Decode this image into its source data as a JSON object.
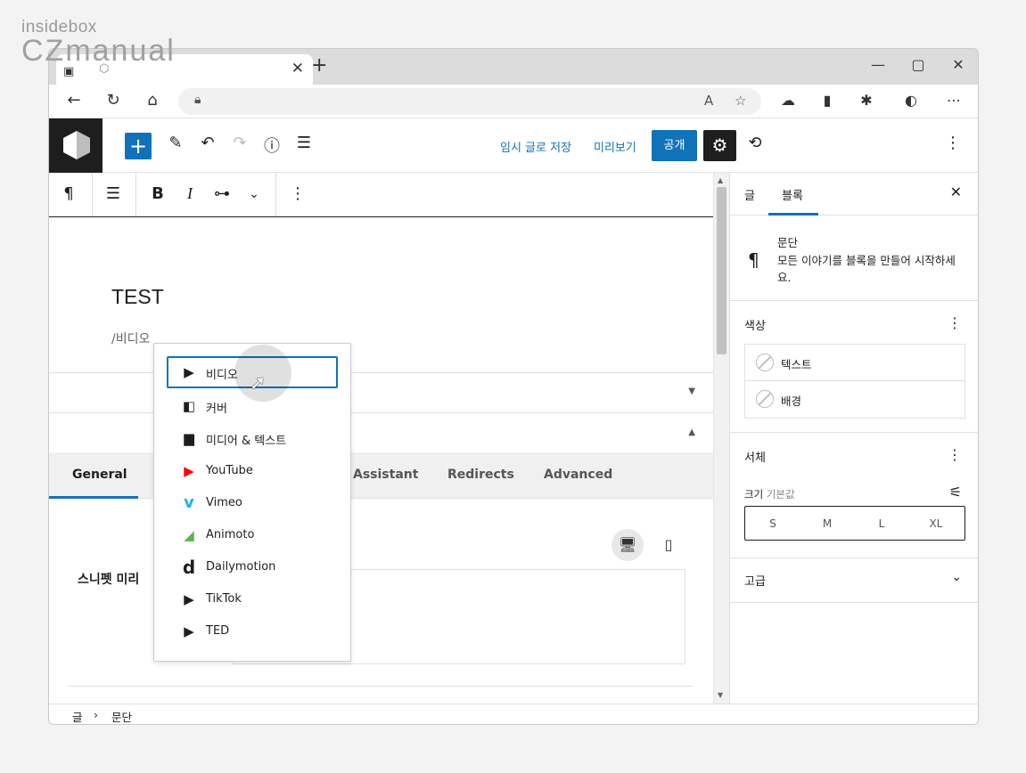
{
  "watermark": {
    "top": "insidebox",
    "bottom": "CZmanual"
  },
  "browser": {
    "tab_title": "",
    "tab_close": "✕",
    "new_tab": "+",
    "win_min": "—",
    "win_max": "▢",
    "win_close": "✕"
  },
  "wp_toolbar": {
    "save_draft": "임시 글로 저장",
    "preview": "미리보기",
    "publish": "공개"
  },
  "editor": {
    "title": "TEST",
    "slash_command": "/비디오"
  },
  "inserter": {
    "items": [
      {
        "label": "비디오",
        "icon": "video-icon",
        "color": "#1e1e1e"
      },
      {
        "label": "커버",
        "icon": "cover-icon",
        "color": "#1e1e1e"
      },
      {
        "label": "미디어 & 텍스트",
        "icon": "media-text-icon",
        "color": "#1e1e1e"
      },
      {
        "label": "YouTube",
        "icon": "youtube-icon",
        "color": "#ff0000"
      },
      {
        "label": "Vimeo",
        "icon": "vimeo-icon",
        "color": "#1ab7ea"
      },
      {
        "label": "Animoto",
        "icon": "animoto-icon",
        "color": "#5ab54a"
      },
      {
        "label": "Dailymotion",
        "icon": "dailymotion-icon",
        "color": "#1e1e1e"
      },
      {
        "label": "TikTok",
        "icon": "tiktok-icon",
        "color": "#1e1e1e"
      },
      {
        "label": "TED",
        "icon": "ted-icon",
        "color": "#1e1e1e"
      }
    ]
  },
  "yoast": {
    "tabs": [
      "General",
      "Assistant",
      "Redirects",
      "Advanced"
    ],
    "snippet_label": "스니펫 미리"
  },
  "sidebar": {
    "tab_post": "글",
    "tab_block": "블록",
    "block_name": "문단",
    "block_desc": "모든 이야기를 블록을 만들어 시작하세요.",
    "color_title": "색상",
    "color_text": "텍스트",
    "color_bg": "배경",
    "typography_title": "서체",
    "size_label": "크기",
    "size_default": "기본값",
    "sizes": [
      "S",
      "M",
      "L",
      "XL"
    ],
    "advanced_title": "고급"
  },
  "footer": {
    "crumb_post": "글",
    "crumb_sep": "›",
    "crumb_block": "문단"
  }
}
